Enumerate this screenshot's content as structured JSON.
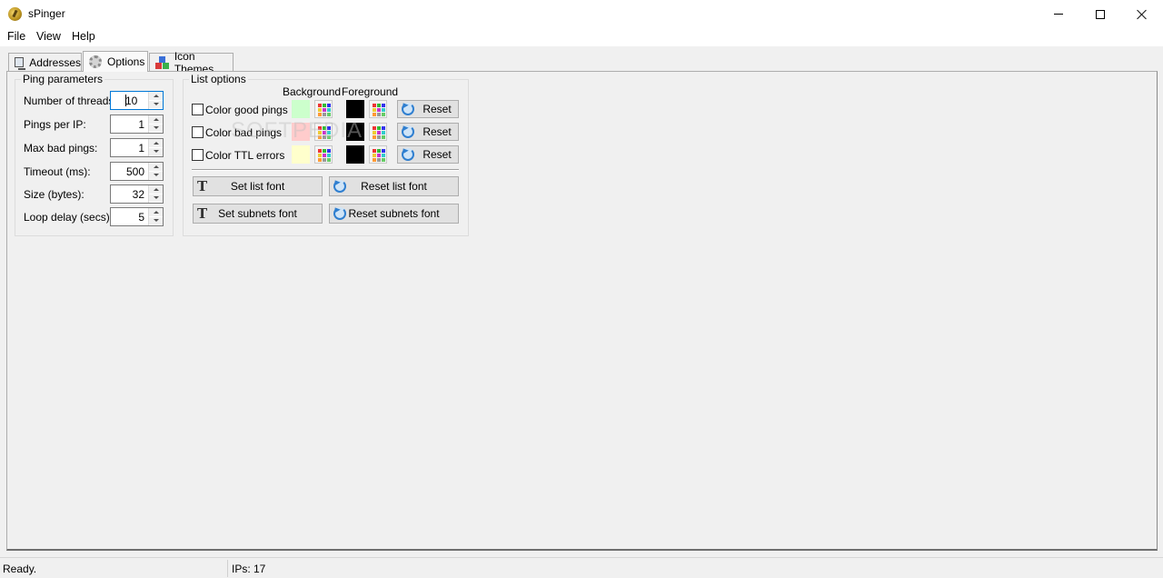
{
  "window": {
    "title": "sPinger"
  },
  "menu": {
    "file": "File",
    "view": "View",
    "help": "Help"
  },
  "tabs": [
    {
      "label": "Addresses"
    },
    {
      "label": "Options"
    },
    {
      "label": "Icon Themes"
    }
  ],
  "ping_parameters": {
    "title": "Ping parameters",
    "fields": [
      {
        "label": "Number of threads:",
        "value": "10"
      },
      {
        "label": "Pings per IP:",
        "value": "1"
      },
      {
        "label": "Max bad pings:",
        "value": "1"
      },
      {
        "label": "Timeout (ms):",
        "value": "500"
      },
      {
        "label": "Size (bytes):",
        "value": "32"
      },
      {
        "label": "Loop delay (secs):",
        "value": "5"
      }
    ]
  },
  "list_options": {
    "title": "List options",
    "background_header": "Background",
    "foreground_header": "Foreground",
    "rows": [
      {
        "label": "Color good pings",
        "checked": false,
        "background": "#ccffcc",
        "foreground": "#000000",
        "reset_label": "Reset"
      },
      {
        "label": "Color bad pings",
        "checked": false,
        "background": "#ffcccc",
        "foreground": "#000000",
        "reset_label": "Reset"
      },
      {
        "label": "Color TTL errors",
        "checked": false,
        "background": "#ffffcc",
        "foreground": "#000000",
        "reset_label": "Reset"
      }
    ],
    "set_list_font": "Set list font",
    "reset_list_font": "Reset list font",
    "set_subnets_font": "Set subnets font",
    "reset_subnets_font": "Reset subnets font"
  },
  "watermark": "SOFTPEDIA",
  "status": {
    "text": "Ready.",
    "ips": "IPs: 17"
  }
}
